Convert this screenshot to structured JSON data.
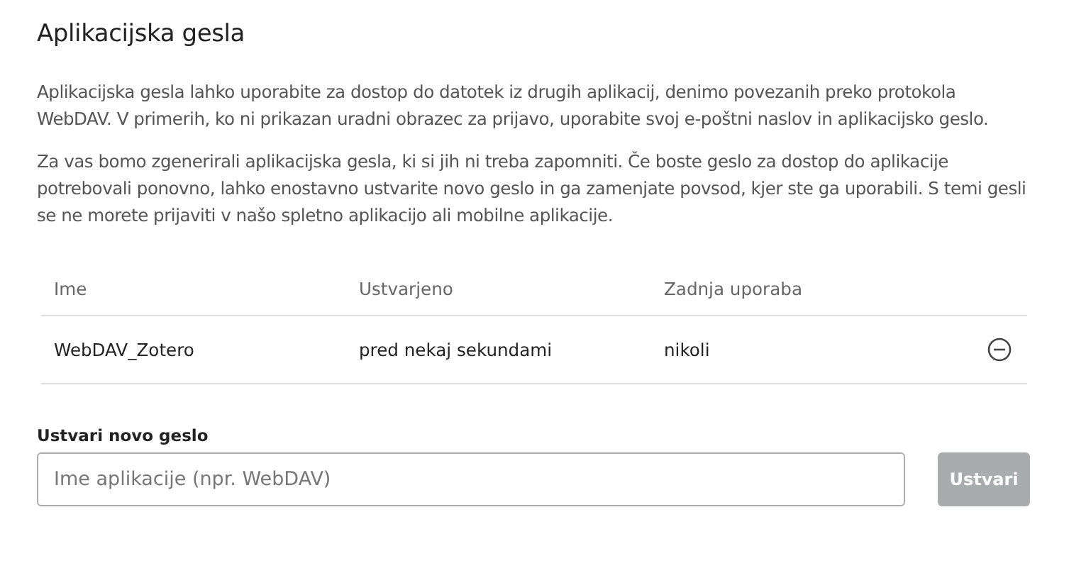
{
  "title": "Aplikacijska gesla",
  "paragraphs": [
    "Aplikacijska gesla lahko uporabite za dostop do datotek iz drugih aplikacij, denimo povezanih preko protokola WebDAV. V primerih, ko ni prikazan uradni obrazec za prijavo, uporabite svoj e-poštni naslov in aplikacijsko geslo.",
    "Za vas bomo zgenerirali aplikacijska gesla, ki si jih ni treba zapomniti. Če boste geslo za dostop do aplikacije potrebovali ponovno, lahko enostavno ustvarite novo geslo in ga zamenjate povsod, kjer ste ga uporabili. S temi gesli se ne morete prijaviti v našo spletno aplikacijo ali mobilne aplikacije."
  ],
  "table": {
    "columns": [
      "Ime",
      "Ustvarjeno",
      "Zadnja uporaba"
    ],
    "rows": [
      {
        "cells": [
          "WebDAV_Zotero",
          "pred nekaj sekundami",
          "nikoli"
        ]
      }
    ]
  },
  "create": {
    "label": "Ustvari novo geslo",
    "placeholder": "Ime aplikacije (npr. WebDAV)",
    "button": "Ustvari",
    "disabled": true
  }
}
